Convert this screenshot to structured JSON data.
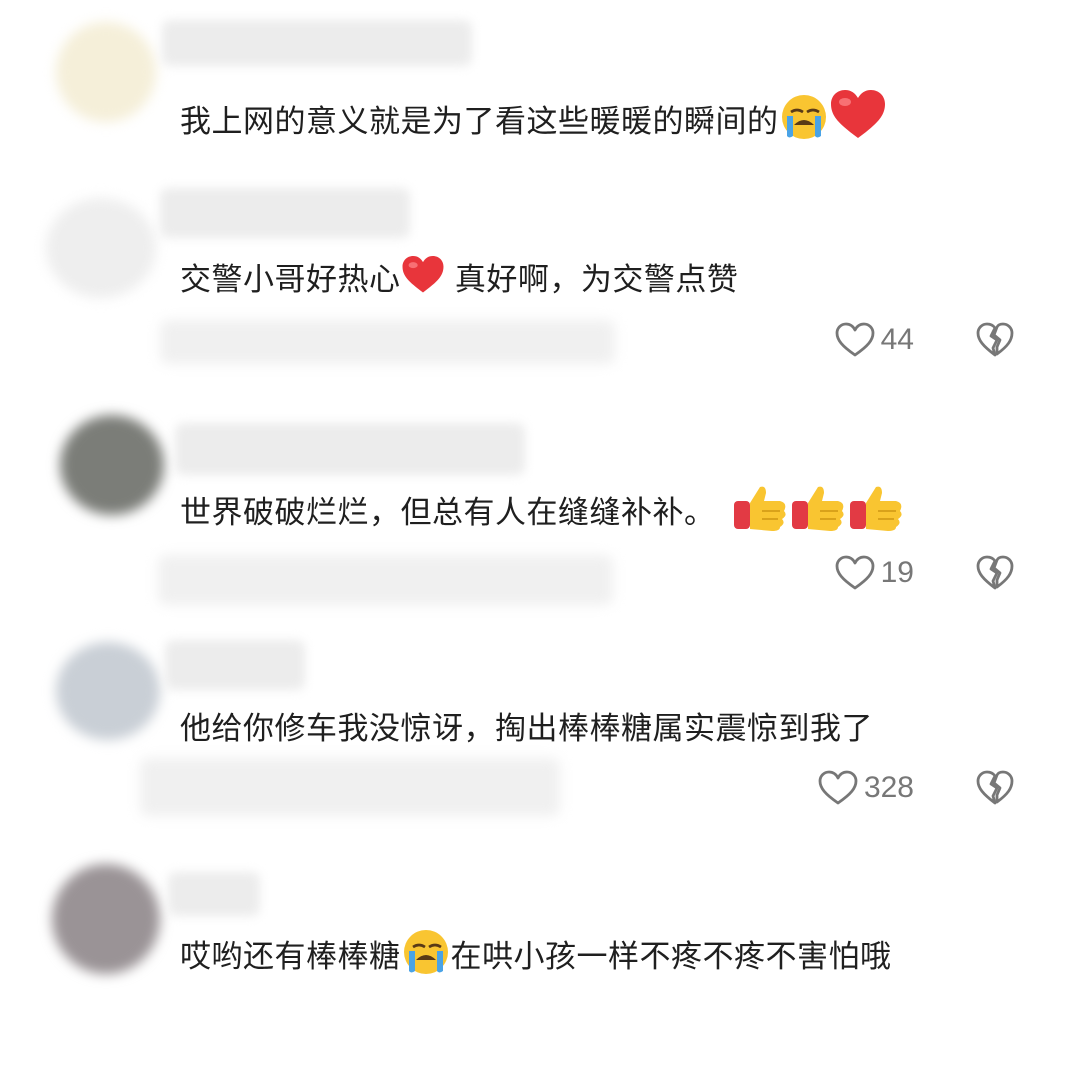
{
  "comments": [
    {
      "text": "我上网的意义就是为了看这些暖暖的瞬间的",
      "emojis": [
        "loudly-crying-face-icon",
        "red-heart-icon"
      ],
      "likes": null,
      "avatar_color": "#f5efd9"
    },
    {
      "text_before": "交警小哥好热心",
      "text_after": " 真好啊，为交警点赞",
      "emojis": [
        "red-heart-icon"
      ],
      "likes": "44",
      "avatar_color": "#eeeeee"
    },
    {
      "text": "世界破破烂烂，但总有人在缝缝补补。",
      "emojis": [
        "thumbs-up-icon",
        "thumbs-up-icon",
        "thumbs-up-icon"
      ],
      "likes": "19",
      "avatar_color": "#7b7d78"
    },
    {
      "text": "他给你修车我没惊讶，掏出棒棒糖属实震惊到我了",
      "emojis": [],
      "likes": "328",
      "avatar_color": "#c9cfd6"
    },
    {
      "text_before": "哎哟还有棒棒糖",
      "text_after": "在哄小孩一样不疼不疼不害怕哦",
      "emojis": [
        "loudly-crying-face-icon"
      ],
      "likes": null,
      "avatar_color": "#9a9396"
    }
  ],
  "colors": {
    "text": "#1f1f1f",
    "muted": "#777777",
    "heart": "#e8353b",
    "emoji_yellow": "#f9c531"
  }
}
